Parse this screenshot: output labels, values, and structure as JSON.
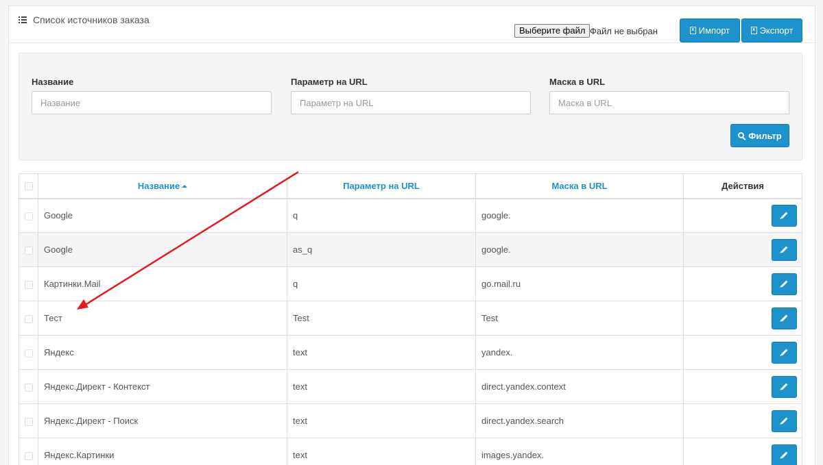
{
  "header": {
    "title": "Список источников заказа",
    "file_button": "Выберите файл",
    "file_status": "Файл не выбран",
    "import_label": "Импорт",
    "export_label": "Экспорт"
  },
  "filter": {
    "name_label": "Название",
    "name_placeholder": "Название",
    "param_label": "Параметр на URL",
    "param_placeholder": "Параметр на URL",
    "mask_label": "Маска в URL",
    "mask_placeholder": "Маска в URL",
    "filter_button": "Фильтр"
  },
  "table": {
    "columns": [
      "Название",
      "Параметр на URL",
      "Маска в URL",
      "Действия"
    ],
    "rows": [
      {
        "name": "Google",
        "param": "q",
        "mask": "google."
      },
      {
        "name": "Google",
        "param": "as_q",
        "mask": "google."
      },
      {
        "name": "Картинки.Mail",
        "param": "q",
        "mask": "go.mail.ru"
      },
      {
        "name": "Тест",
        "param": "Test",
        "mask": "Test"
      },
      {
        "name": "Яндекс",
        "param": "text",
        "mask": "yandex."
      },
      {
        "name": "Яндекс.Директ - Контекст",
        "param": "text",
        "mask": "direct.yandex.context"
      },
      {
        "name": "Яндекс.Директ - Поиск",
        "param": "text",
        "mask": "direct.yandex.search"
      },
      {
        "name": "Яндекс.Картинки",
        "param": "text",
        "mask": "images.yandex."
      }
    ]
  },
  "colors": {
    "accent": "#1e91cf",
    "annotation_arrow": "#e8191c"
  }
}
